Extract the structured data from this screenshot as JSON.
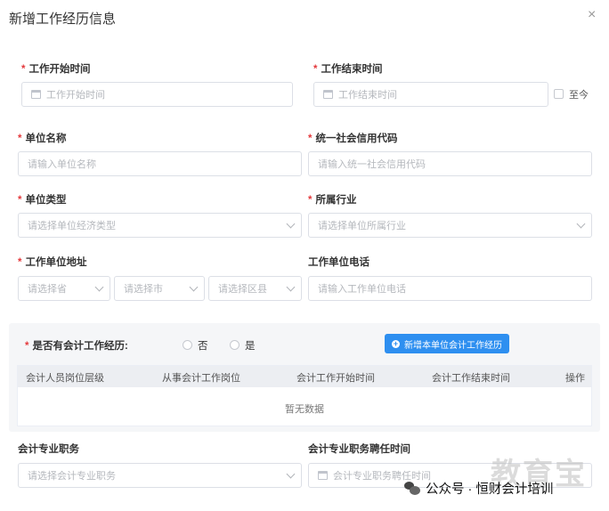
{
  "dialog": {
    "title": "新增工作经历信息",
    "close": "×"
  },
  "fields": {
    "start_time": {
      "label": "工作开始时间",
      "placeholder": "工作开始时间",
      "required": true
    },
    "end_time": {
      "label": "工作结束时间",
      "placeholder": "工作结束时间",
      "required": true
    },
    "until_now": {
      "label": "至今"
    },
    "company_name": {
      "label": "单位名称",
      "placeholder": "请输入单位名称",
      "required": true
    },
    "credit_code": {
      "label": "统一社会信用代码",
      "placeholder": "请输入统一社会信用代码",
      "required": true
    },
    "company_type": {
      "label": "单位类型",
      "placeholder": "请选择单位经济类型",
      "required": true
    },
    "industry": {
      "label": "所属行业",
      "placeholder": "请选择单位所属行业",
      "required": true
    },
    "address": {
      "label": "工作单位地址",
      "required": true,
      "province": "请选择省",
      "city": "请选择市",
      "district": "请选择区县"
    },
    "phone": {
      "label": "工作单位电话",
      "placeholder": "请输入工作单位电话"
    },
    "has_accounting": {
      "label": "是否有会计工作经历:",
      "option_no": "否",
      "option_yes": "是",
      "required": true
    },
    "add_button": "新增本单位会计工作经历",
    "professional_title": {
      "label": "会计专业职务",
      "placeholder": "请选择会计专业职务"
    },
    "appointment_time": {
      "label": "会计专业职务聘任时间",
      "placeholder": "会计专业职务聘任时间"
    }
  },
  "table": {
    "columns": [
      "会计人员岗位层级",
      "从事会计工作岗位",
      "会计工作开始时间",
      "会计工作结束时间",
      "操作"
    ],
    "empty_text": "暂无数据"
  },
  "watermark": {
    "text": "公众号 · 恒财会计培训",
    "brand": "教育宝"
  },
  "icons": {
    "close": "close-icon",
    "calendar": "calendar-icon",
    "chevron": "chevron-down-icon",
    "plus": "plus-circle-icon",
    "wechat": "wechat-icon"
  },
  "colors": {
    "primary": "#2e8ff0",
    "required": "#e4393c",
    "border": "#dcdfe6",
    "placeholder": "#b5b8bd"
  }
}
